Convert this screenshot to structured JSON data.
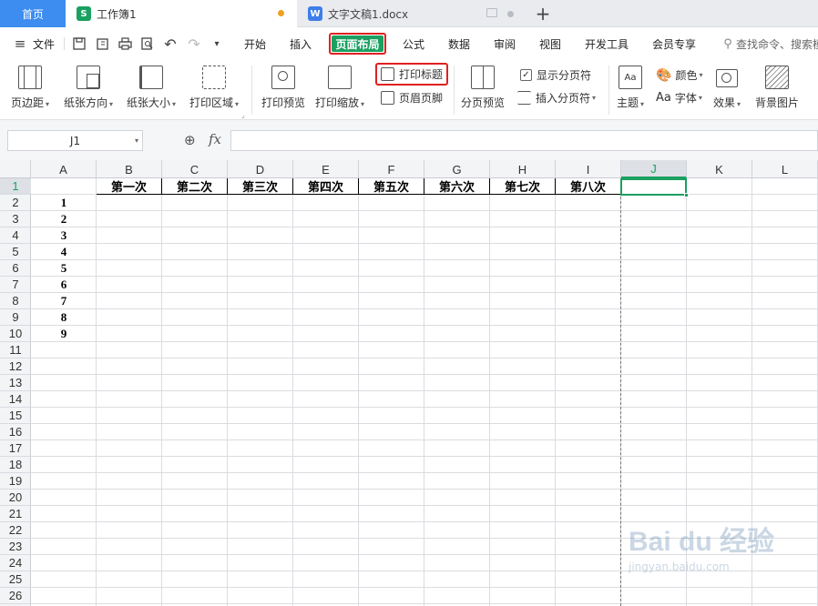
{
  "tabs": {
    "home": "首页",
    "workbook": "工作簿1",
    "document": "文字文稿1.docx"
  },
  "colors": {
    "accent_green": "#1aa060",
    "tab_blue": "#3d8cf0",
    "highlight_red": "#e02020",
    "unsaved_dot": "#f0a020"
  },
  "menu": {
    "file": "文件",
    "items": [
      "开始",
      "插入",
      "页面布局",
      "公式",
      "数据",
      "审阅",
      "视图",
      "开发工具",
      "会员专享"
    ],
    "active": "页面布局",
    "search": "查找命令、搜索模"
  },
  "ribbon": {
    "margins": "页边距",
    "orientation": "纸张方向",
    "size": "纸张大小",
    "print_area": "打印区域",
    "print_preview": "打印预览",
    "print_scale": "打印缩放",
    "print_titles": "打印标题",
    "header_footer": "页眉页脚",
    "page_break_preview": "分页预览",
    "show_page_breaks": "显示分页符",
    "insert_page_break": "插入分页符",
    "theme": "主题",
    "colors": "颜色",
    "fonts": "字体",
    "effects": "效果",
    "background": "背景图片"
  },
  "formula_bar": {
    "name_box": "J1",
    "fx": "fx",
    "value": ""
  },
  "sheet": {
    "columns": [
      "A",
      "B",
      "C",
      "D",
      "E",
      "F",
      "G",
      "H",
      "I",
      "J",
      "K",
      "L"
    ],
    "selected_column": "J",
    "rows": [
      "1",
      "2",
      "3",
      "4",
      "5",
      "6",
      "7",
      "8",
      "9",
      "10",
      "11",
      "12",
      "13",
      "14",
      "15",
      "16",
      "17",
      "18",
      "19",
      "20",
      "21",
      "22",
      "23",
      "24",
      "25",
      "26"
    ],
    "selected_row": "1",
    "header_row": [
      "第一次",
      "第二次",
      "第三次",
      "第四次",
      "第五次",
      "第六次",
      "第七次",
      "第八次"
    ],
    "column_a_values": [
      "1",
      "2",
      "3",
      "4",
      "5",
      "6",
      "7",
      "8",
      "9"
    ]
  },
  "watermark": {
    "brand": "Bai du 经验",
    "url": "jingyan.baidu.com"
  }
}
